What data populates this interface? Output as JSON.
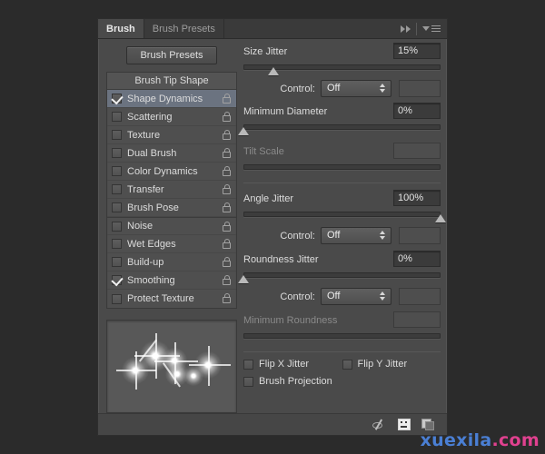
{
  "panel": {
    "tabs": [
      {
        "label": "Brush",
        "active": true
      },
      {
        "label": "Brush Presets",
        "active": false
      }
    ],
    "collapse_icon": "double-chevron-right-icon",
    "menu_icon": "panel-menu-icon"
  },
  "sidebar": {
    "presets_button": "Brush Presets",
    "list_header": "Brush Tip Shape",
    "items": [
      {
        "label": "Shape Dynamics",
        "checked": true,
        "selected": true,
        "locked": true
      },
      {
        "label": "Scattering",
        "checked": false,
        "selected": false,
        "locked": true
      },
      {
        "label": "Texture",
        "checked": false,
        "selected": false,
        "locked": true
      },
      {
        "label": "Dual Brush",
        "checked": false,
        "selected": false,
        "locked": true
      },
      {
        "label": "Color Dynamics",
        "checked": false,
        "selected": false,
        "locked": true
      },
      {
        "label": "Transfer",
        "checked": false,
        "selected": false,
        "locked": true
      },
      {
        "label": "Brush Pose",
        "checked": false,
        "selected": false,
        "locked": true
      },
      {
        "label": "Noise",
        "checked": false,
        "selected": false,
        "locked": true
      },
      {
        "label": "Wet Edges",
        "checked": false,
        "selected": false,
        "locked": true
      },
      {
        "label": "Build-up",
        "checked": false,
        "selected": false,
        "locked": true
      },
      {
        "label": "Smoothing",
        "checked": true,
        "selected": false,
        "locked": true
      },
      {
        "label": "Protect Texture",
        "checked": false,
        "selected": false,
        "locked": true
      }
    ],
    "preview_name": "brush-stroke-preview"
  },
  "properties": {
    "size_jitter": {
      "label": "Size Jitter",
      "value": "15%",
      "slider_percent": 15,
      "enabled": true
    },
    "size_control": {
      "label": "Control:",
      "value": "Off"
    },
    "minimum_diameter": {
      "label": "Minimum Diameter",
      "value": "0%",
      "slider_percent": 0,
      "enabled": true
    },
    "tilt_scale": {
      "label": "Tilt Scale",
      "value": "",
      "slider_percent": 0,
      "enabled": false
    },
    "angle_jitter": {
      "label": "Angle Jitter",
      "value": "100%",
      "slider_percent": 100,
      "enabled": true
    },
    "angle_control": {
      "label": "Control:",
      "value": "Off"
    },
    "roundness_jitter": {
      "label": "Roundness Jitter",
      "value": "0%",
      "slider_percent": 0,
      "enabled": true
    },
    "roundness_control": {
      "label": "Control:",
      "value": "Off"
    },
    "minimum_roundness": {
      "label": "Minimum Roundness",
      "value": "",
      "slider_percent": 0,
      "enabled": false
    },
    "flip_x_jitter": {
      "label": "Flip X Jitter",
      "checked": false
    },
    "flip_y_jitter": {
      "label": "Flip Y Jitter",
      "checked": false
    },
    "brush_projection": {
      "label": "Brush Projection",
      "checked": false
    }
  },
  "footer": {
    "icons": [
      {
        "name": "toggle-brush-stroke-icon"
      },
      {
        "name": "open-brush-presets-icon"
      },
      {
        "name": "create-new-brush-icon"
      }
    ]
  },
  "watermark": {
    "primary": "xuexila",
    "suffix": ".com"
  },
  "colors": {
    "panel_bg": "#4a4a4a",
    "tab_bg": "#3a3a3a",
    "selection": "#6b7380",
    "text": "#dcdcdc",
    "text_disabled": "#8a8a8a",
    "field_bg": "#3b3b3b",
    "watermark_primary": "#4a7fd4",
    "watermark_suffix": "#e0418f"
  }
}
